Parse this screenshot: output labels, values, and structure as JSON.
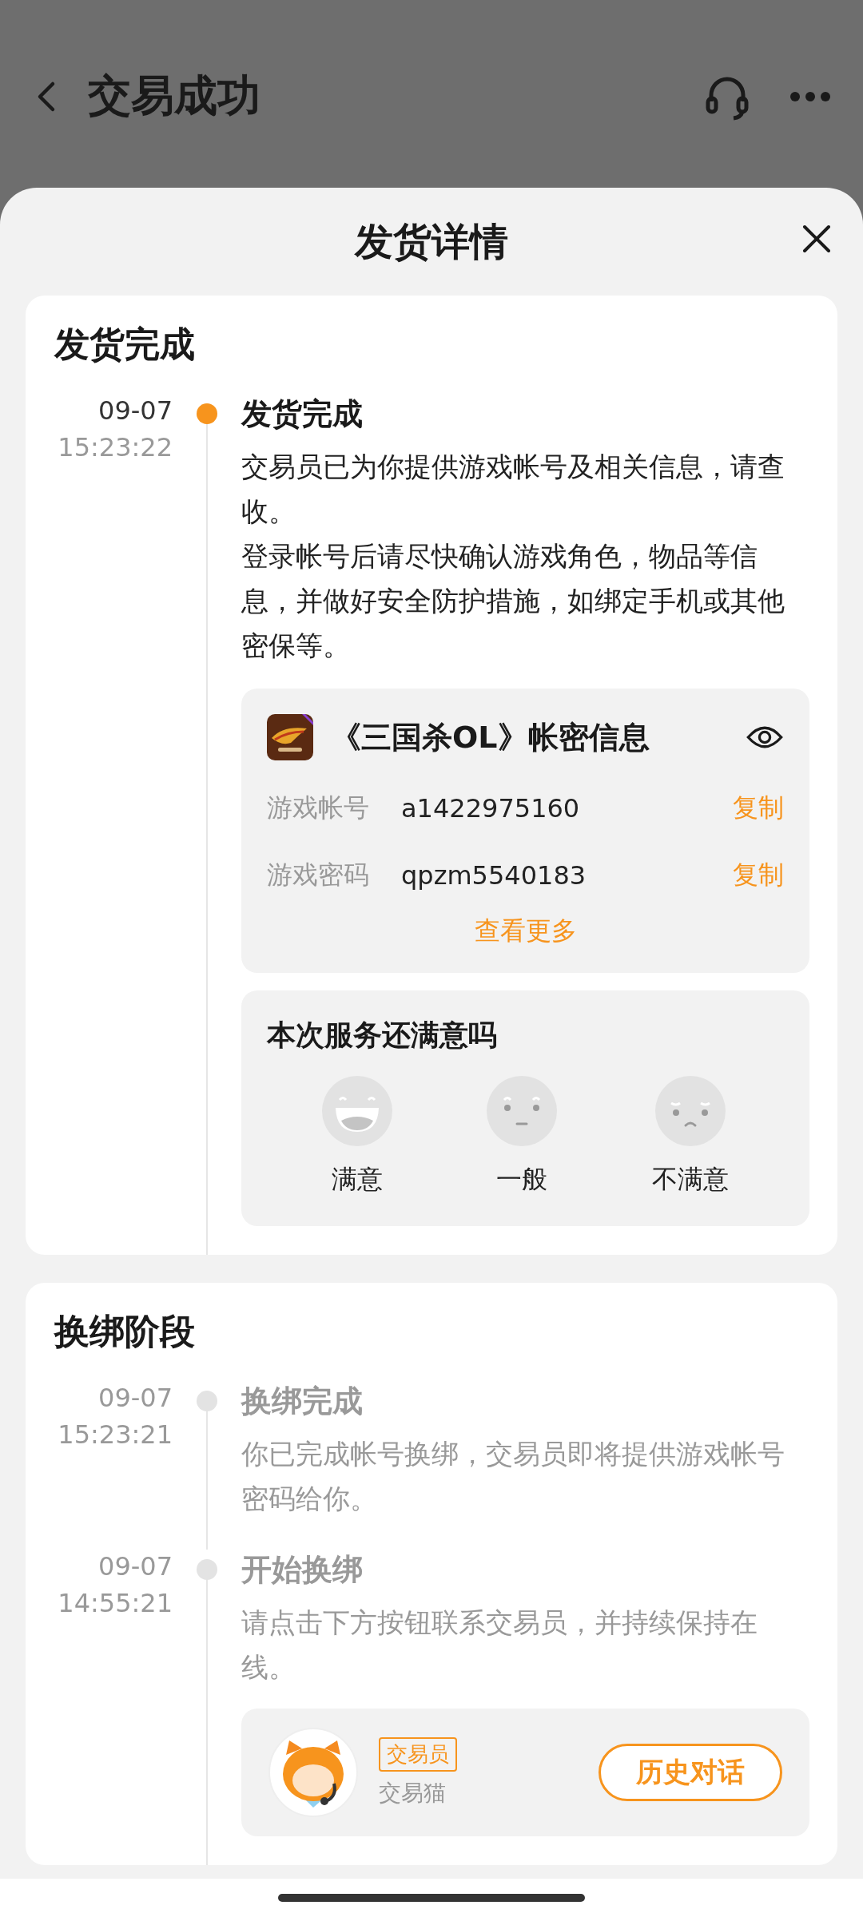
{
  "nav": {
    "title": "交易成功"
  },
  "sheet": {
    "title": "发货详情"
  },
  "sections": [
    {
      "title": "发货完成",
      "events": [
        {
          "date": "09-07",
          "time": "15:23:22",
          "title": "发货完成",
          "active": true,
          "paragraphs": [
            "交易员已为你提供游戏帐号及相关信息，请查收。",
            "登录帐号后请尽快确认游戏角色，物品等信息，并做好安全防护措施，如绑定手机或其他密保等。"
          ],
          "attachments": [
            {
              "kind": "account",
              "title": "《三国杀OL》帐密信息",
              "rows": [
                {
                  "label": "游戏帐号",
                  "value": "a1422975160",
                  "action": "复制"
                },
                {
                  "label": "游戏密码",
                  "value": "qpzm5540183",
                  "action": "复制"
                }
              ],
              "more": "查看更多"
            },
            {
              "kind": "rating",
              "title": "本次服务还满意吗",
              "options": [
                {
                  "kind": "happy",
                  "label": "满意"
                },
                {
                  "kind": "neutral",
                  "label": "一般"
                },
                {
                  "kind": "sad",
                  "label": "不满意"
                }
              ]
            }
          ]
        }
      ]
    },
    {
      "title": "换绑阶段",
      "events": [
        {
          "date": "09-07",
          "time": "15:23:21",
          "title": "换绑完成",
          "active": false,
          "paragraphs": [
            "你已完成帐号换绑，交易员即将提供游戏帐号密码给你。"
          ]
        },
        {
          "date": "09-07",
          "time": "14:55:21",
          "title": "开始换绑",
          "active": false,
          "paragraphs": [
            "请点击下方按钮联系交易员，并持续保持在线。"
          ],
          "attachments": [
            {
              "kind": "agent",
              "badge": "交易员",
              "name": "交易猫",
              "button": "历史对话"
            }
          ]
        }
      ]
    }
  ]
}
